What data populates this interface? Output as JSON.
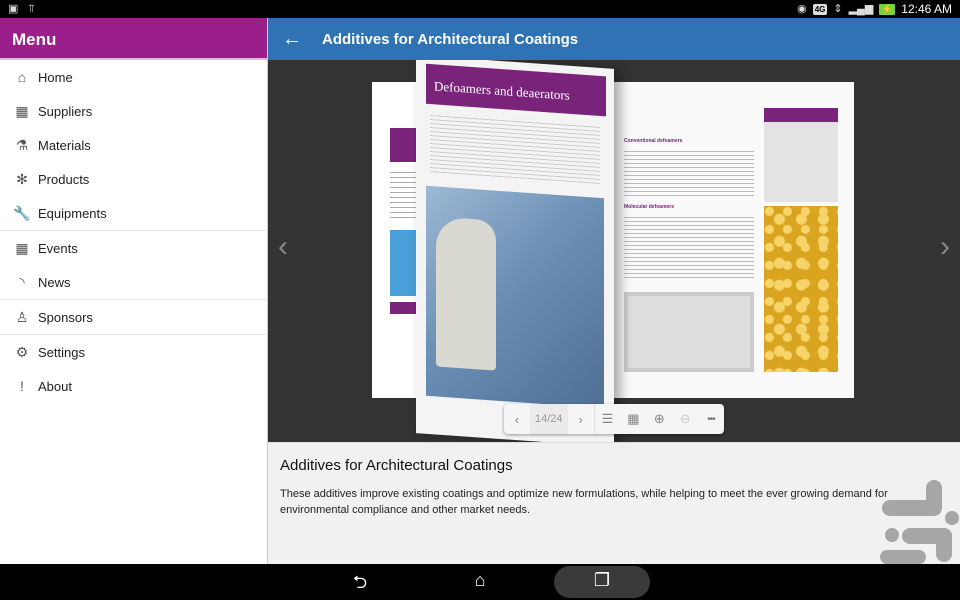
{
  "statusbar": {
    "left_icons": [
      "gallery-icon",
      "usb-icon"
    ],
    "network_label": "4G",
    "time": "12:46 AM"
  },
  "sidebar": {
    "title": "Menu",
    "groups": [
      [
        {
          "label": "Home",
          "icon": "home-icon",
          "glyph": "⌂"
        },
        {
          "label": "Suppliers",
          "icon": "building-icon",
          "glyph": "▦"
        },
        {
          "label": "Materials",
          "icon": "flask-icon",
          "glyph": "⚗"
        },
        {
          "label": "Products",
          "icon": "products-icon",
          "glyph": "✻"
        },
        {
          "label": "Equipments",
          "icon": "wrench-icon",
          "glyph": "🔧"
        }
      ],
      [
        {
          "label": "Events",
          "icon": "calendar-icon",
          "glyph": "▦"
        },
        {
          "label": "News",
          "icon": "rss-icon",
          "glyph": "◝"
        }
      ],
      [
        {
          "label": "Sponsors",
          "icon": "award-icon",
          "glyph": "♙"
        }
      ],
      [
        {
          "label": "Settings",
          "icon": "gear-icon",
          "glyph": "⚙"
        },
        {
          "label": "About",
          "icon": "exclamation-icon",
          "glyph": "!"
        }
      ]
    ]
  },
  "appbar": {
    "title": "Additives for Architectural Coatings",
    "back_glyph": "←"
  },
  "viewer": {
    "page_heading": "Defoamers and deaerators",
    "right_headings": [
      "Conventional defoamers",
      "Molecular defoamers"
    ],
    "toolbar": {
      "prev_glyph": "‹",
      "page_indicator": "14/24",
      "next_glyph": "›",
      "toc_glyph": "☰",
      "grid_glyph": "▦",
      "zoom_in_glyph": "⊕",
      "zoom_out_glyph": "⊖",
      "more_glyph": "•••"
    },
    "prev_arrow": "‹",
    "next_arrow": "›"
  },
  "description": {
    "title": "Additives for Architectural Coatings",
    "body": "These additives improve existing coatings and optimize new formulations, while helping to meet the ever growing demand for environmental compliance and other market needs."
  },
  "navbar": {
    "back_glyph": "⮌",
    "home_glyph": "⌂",
    "recents_glyph": "❐"
  },
  "colors": {
    "menu_header": "#9b1f8a",
    "appbar": "#2f73b5",
    "brochure_purple": "#7a237a"
  }
}
